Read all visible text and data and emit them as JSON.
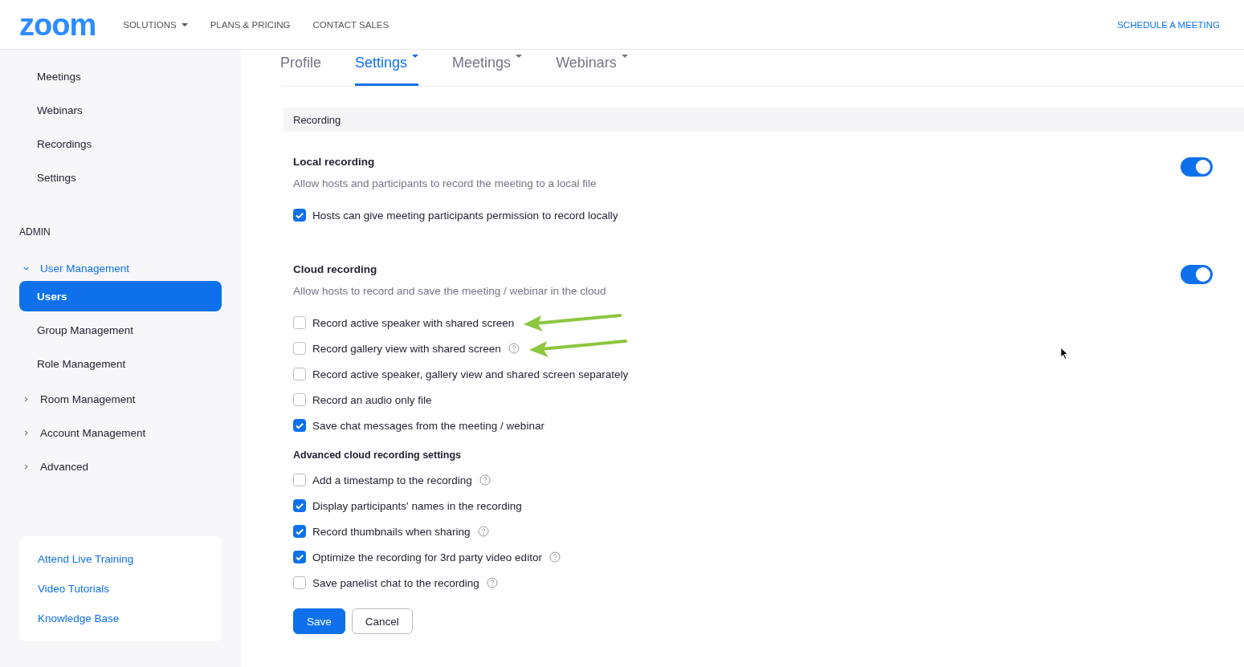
{
  "header": {
    "logo": "zoom",
    "nav": [
      {
        "label": "SOLUTIONS",
        "dropdown": true
      },
      {
        "label": "PLANS & PRICING",
        "dropdown": false
      },
      {
        "label": "CONTACT SALES",
        "dropdown": false
      }
    ],
    "action": "SCHEDULE A MEETING"
  },
  "sidebar": {
    "items": [
      {
        "label": "Meetings",
        "selected": false
      },
      {
        "label": "Webinars",
        "selected": false
      },
      {
        "label": "Recordings",
        "selected": false
      },
      {
        "label": "Settings",
        "selected": false
      }
    ],
    "admin_heading": "ADMIN",
    "groups": [
      {
        "label": "User Management",
        "expanded": true,
        "children": [
          {
            "label": "Users",
            "selected": true
          },
          {
            "label": "Group Management",
            "selected": false
          },
          {
            "label": "Role Management",
            "selected": false
          }
        ]
      },
      {
        "label": "Room Management",
        "expanded": false
      },
      {
        "label": "Account Management",
        "expanded": false
      },
      {
        "label": "Advanced",
        "expanded": false
      }
    ],
    "help_links": [
      "Attend Live Training",
      "Video Tutorials",
      "Knowledge Base"
    ]
  },
  "tabs": [
    {
      "label": "Profile",
      "selected": false,
      "dropdown": false
    },
    {
      "label": "Settings",
      "selected": true,
      "dropdown": true
    },
    {
      "label": "Meetings",
      "selected": false,
      "dropdown": true
    },
    {
      "label": "Webinars",
      "selected": false,
      "dropdown": true
    }
  ],
  "section_title": "Recording",
  "settings": [
    {
      "title": "Local recording",
      "description": "Allow hosts and participants to record the meeting to a local file",
      "on": true,
      "options": [
        {
          "label": "Hosts can give meeting participants permission to record locally",
          "checked": true,
          "help": false,
          "annotated": false
        }
      ]
    },
    {
      "title": "Cloud recording",
      "description": "Allow hosts to record and save the meeting / webinar in the cloud",
      "on": true,
      "options": [
        {
          "label": "Record active speaker with shared screen",
          "checked": false,
          "help": false,
          "annotated": true
        },
        {
          "label": "Record gallery view with shared screen",
          "checked": false,
          "help": true,
          "annotated": true
        },
        {
          "label": "Record active speaker, gallery view and shared screen separately",
          "checked": false,
          "help": false,
          "annotated": false
        },
        {
          "label": "Record an audio only file",
          "checked": false,
          "help": false,
          "annotated": false
        },
        {
          "label": "Save chat messages from the meeting / webinar",
          "checked": true,
          "help": false,
          "annotated": false
        }
      ],
      "advanced_heading": "Advanced cloud recording settings",
      "advanced_options": [
        {
          "label": "Add a timestamp to the recording",
          "checked": false,
          "help": true,
          "annotated": false
        },
        {
          "label": "Display participants' names in the recording",
          "checked": true,
          "help": false,
          "annotated": false
        },
        {
          "label": "Record thumbnails when sharing",
          "checked": true,
          "help": true,
          "annotated": false
        },
        {
          "label": "Optimize the recording for 3rd party video editor",
          "checked": true,
          "help": true,
          "annotated": false
        },
        {
          "label": "Save panelist chat to the recording",
          "checked": false,
          "help": true,
          "annotated": false
        }
      ]
    }
  ],
  "buttons": [
    {
      "label": "Save",
      "kind": "primary"
    },
    {
      "label": "Cancel",
      "kind": "secondary"
    }
  ]
}
